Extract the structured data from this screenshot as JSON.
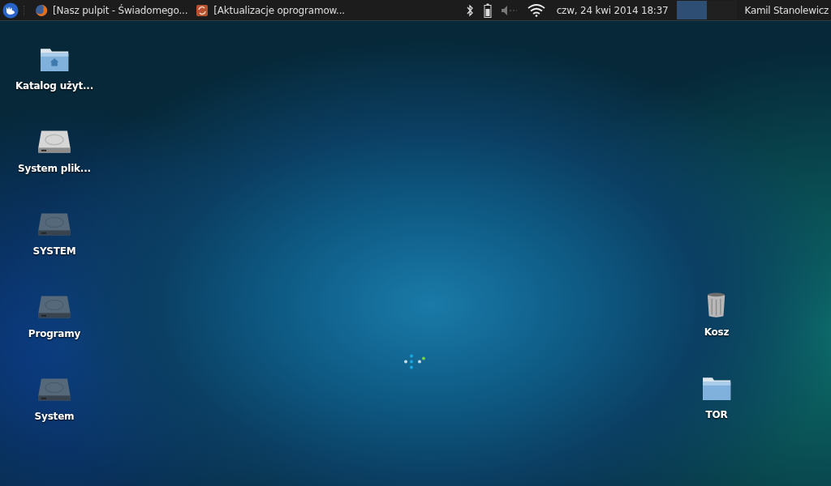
{
  "panel": {
    "tasks": [
      {
        "kind": "browser",
        "title": "[Nasz pulpit - Świadomego..."
      },
      {
        "kind": "updater",
        "title": "[Aktualizacje oprogramow..."
      }
    ],
    "clock": "czw, 24 kwi 2014 18:37",
    "workspaces": [
      {
        "selected": true
      },
      {
        "selected": false
      }
    ],
    "user": "Kamil Stanolewicz"
  },
  "desktop": {
    "left_icons": [
      {
        "kind": "home-folder",
        "label": "Katalog użyt..."
      },
      {
        "kind": "drive",
        "label": "System plik..."
      },
      {
        "kind": "drive-dark",
        "label": "SYSTEM"
      },
      {
        "kind": "drive-dark",
        "label": "Programy"
      },
      {
        "kind": "drive-dark",
        "label": "System"
      }
    ],
    "right_icons": [
      {
        "kind": "trash",
        "label": "Kosz"
      },
      {
        "kind": "folder",
        "label": "TOR"
      }
    ]
  }
}
